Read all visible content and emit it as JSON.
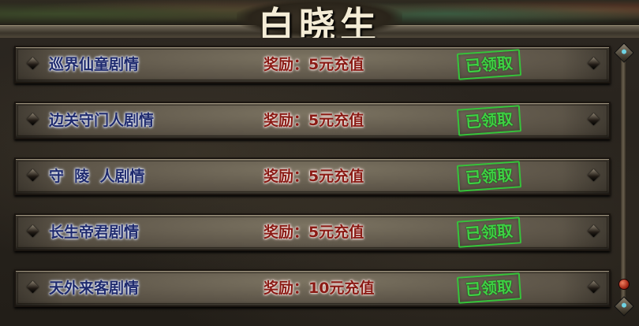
{
  "window": {
    "title": "白晓生"
  },
  "quests": [
    {
      "name": "巡界仙童剧情",
      "reward": "奖励：5元充值",
      "status": "已领取"
    },
    {
      "name": "边关守门人剧情",
      "reward": "奖励：5元充值",
      "status": "已领取"
    },
    {
      "name": "守  陵  人剧情",
      "reward": "奖励：5元充值",
      "status": "已领取"
    },
    {
      "name": "长生帝君剧情",
      "reward": "奖励：5元充值",
      "status": "已领取"
    },
    {
      "name": "天外来客剧情",
      "reward": "奖励：10元充值",
      "status": "已领取"
    }
  ],
  "colors": {
    "name_text": "#1e2a6e",
    "reward_text": "#8a1a14",
    "stamp_green": "#3ed243"
  },
  "icons": [
    "diamond-rivet-icon",
    "scroll-up-icon",
    "scroll-down-icon",
    "scroll-thumb-icon"
  ]
}
